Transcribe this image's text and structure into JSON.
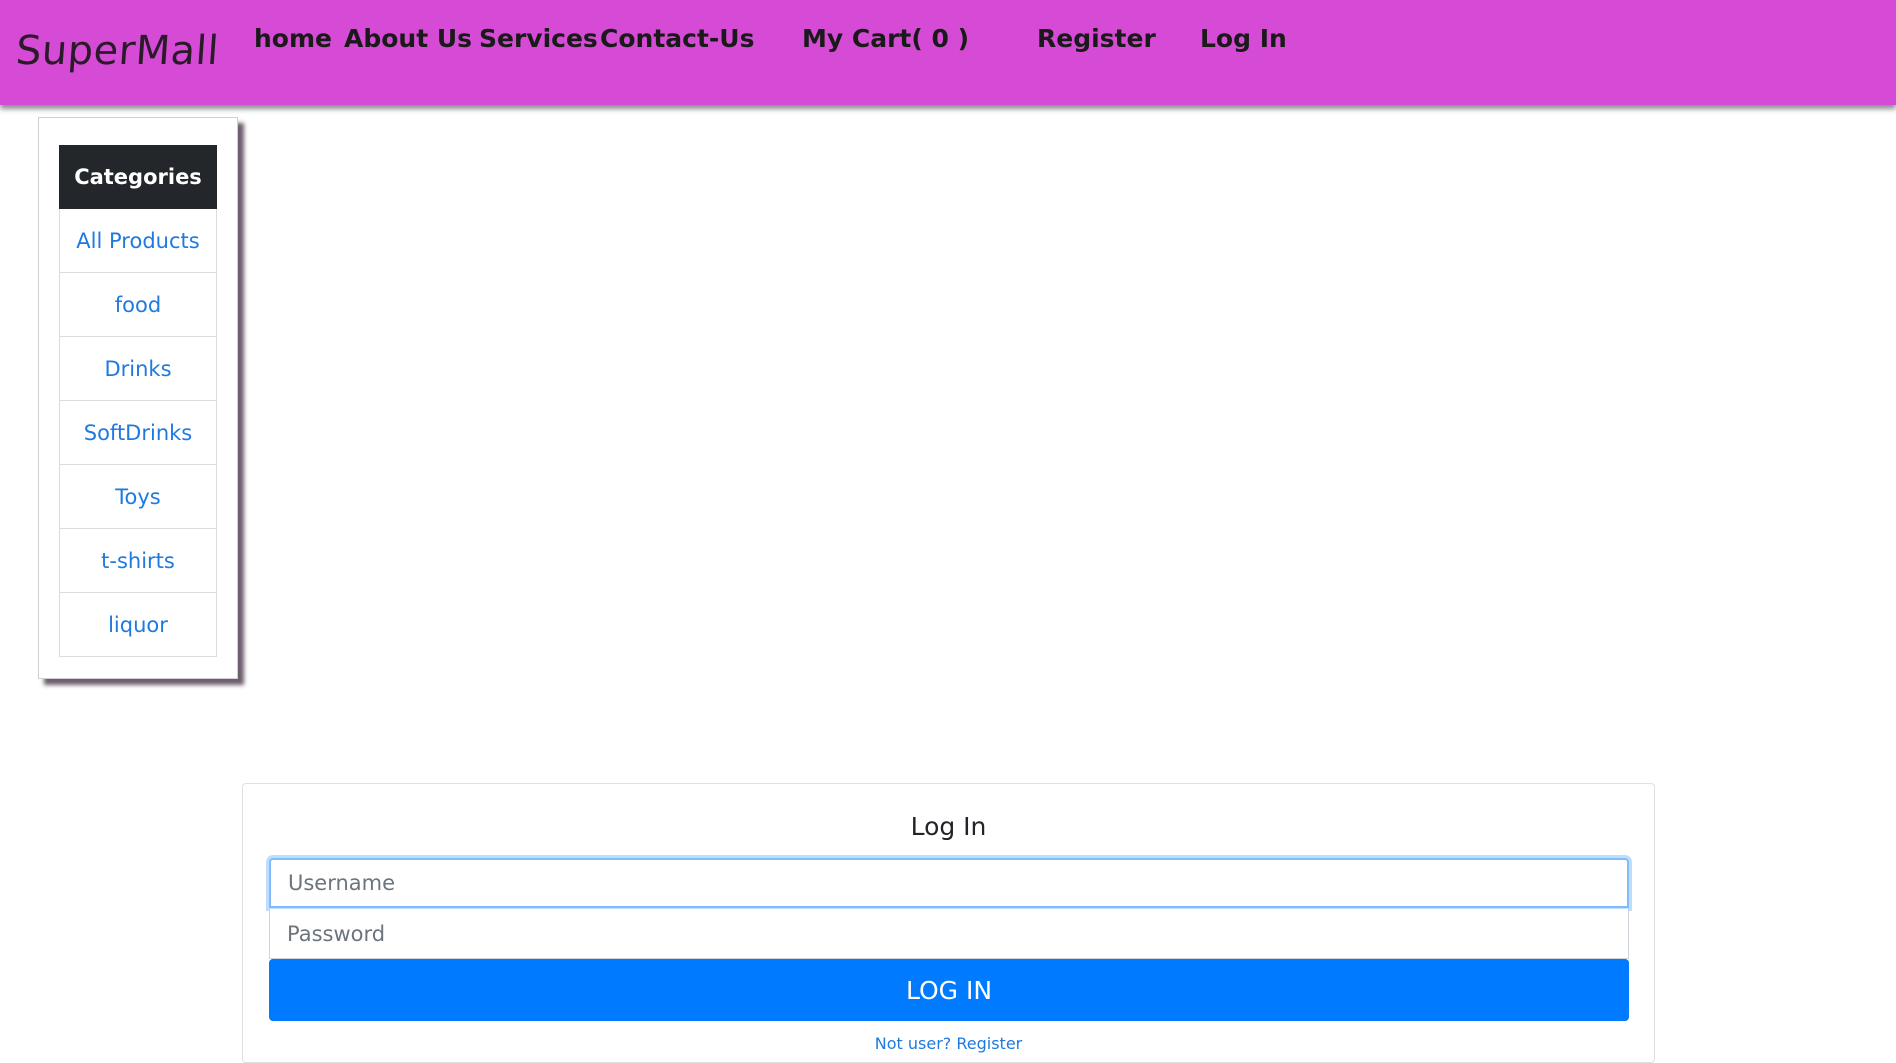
{
  "navbar": {
    "brand": "SuperMall",
    "links": {
      "home": "home",
      "about": "About Us",
      "services": "Services",
      "contact": "Contact-Us",
      "cart": "My Cart( 0 )",
      "register": "Register",
      "login": "Log In"
    },
    "background_color": "#d64bd6"
  },
  "sidebar": {
    "header": "Categories",
    "items": [
      {
        "label": "All Products"
      },
      {
        "label": "food"
      },
      {
        "label": "Drinks"
      },
      {
        "label": "SoftDrinks"
      },
      {
        "label": "Toys"
      },
      {
        "label": "t-shirts"
      },
      {
        "label": "liquor"
      }
    ]
  },
  "login_form": {
    "title": "Log In",
    "username_placeholder": "Username",
    "password_placeholder": "Password",
    "submit_label": "LOG IN",
    "register_link": "Not user? Register",
    "button_color": "#007bff"
  }
}
